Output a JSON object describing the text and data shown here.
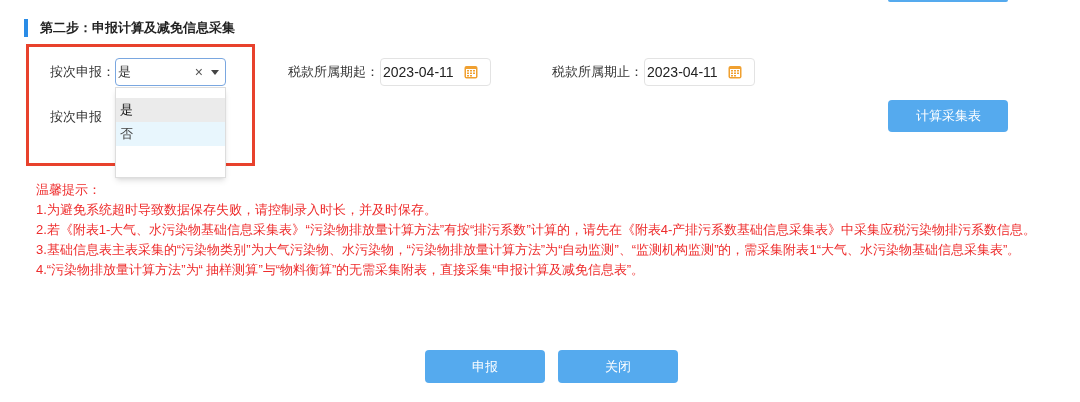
{
  "section_title": "第二步：申报计算及减免信息采集",
  "per_filing": {
    "label": "按次申报：",
    "value": "是",
    "clear": "×",
    "expanded": true,
    "options": [
      {
        "label": "是",
        "selected": true,
        "hovered": false
      },
      {
        "label": "否",
        "selected": false,
        "hovered": true
      }
    ]
  },
  "period_start": {
    "label": "税款所属期起：",
    "value": "2023-04-11"
  },
  "period_end": {
    "label": "税款所属期止：",
    "value": "2023-04-11"
  },
  "second_row_label": "按次申报",
  "calc_button": "计算采集表",
  "tips": {
    "title": "温馨提示：",
    "items": [
      "1.为避免系统超时导致数据保存失败，请控制录入时长，并及时保存。",
      "2.若《附表1-大气、水污染物基础信息采集表》“污染物排放量计算方法”有按“排污系数”计算的，请先在《附表4-产排污系数基础信息采集表》中采集应税污染物排污系数信息。",
      "3.基础信息表主表采集的“污染物类别”为大气污染物、水污染物，“污染物排放量计算方法”为“自动监测”、“监测机构监测”的，需采集附表1“大气、水污染物基础信息采集表”。",
      "4.“污染物排放量计算方法”为“ 抽样测算”与“物料衡算”的无需采集附表，直接采集“申报计算及减免信息表”。"
    ]
  },
  "buttons": [
    "申报",
    "关闭"
  ]
}
